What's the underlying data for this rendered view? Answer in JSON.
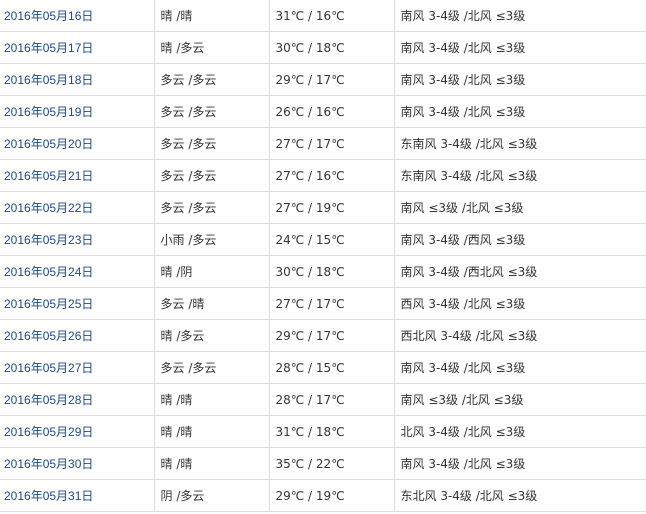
{
  "rows": [
    {
      "date": "2016年05月16日",
      "condition": "晴 /晴",
      "temp": "31℃ / 16℃",
      "wind": "南风 3-4级 /北风 ≤3级"
    },
    {
      "date": "2016年05月17日",
      "condition": "晴 /多云",
      "temp": "30℃ / 18℃",
      "wind": "南风 3-4级 /北风 ≤3级"
    },
    {
      "date": "2016年05月18日",
      "condition": "多云 /多云",
      "temp": "29℃ / 17℃",
      "wind": "南风 3-4级 /北风 ≤3级"
    },
    {
      "date": "2016年05月19日",
      "condition": "多云 /多云",
      "temp": "26℃ / 16℃",
      "wind": "南风 3-4级 /北风 ≤3级"
    },
    {
      "date": "2016年05月20日",
      "condition": "多云 /多云",
      "temp": "27℃ / 17℃",
      "wind": "东南风 3-4级 /北风 ≤3级"
    },
    {
      "date": "2016年05月21日",
      "condition": "多云 /多云",
      "temp": "27℃ / 16℃",
      "wind": "东南风 3-4级 /北风 ≤3级"
    },
    {
      "date": "2016年05月22日",
      "condition": "多云 /多云",
      "temp": "27℃ / 19℃",
      "wind": "南风 ≤3级 /北风 ≤3级"
    },
    {
      "date": "2016年05月23日",
      "condition": "小雨 /多云",
      "temp": "24℃ / 15℃",
      "wind": "南风 3-4级 /西风 ≤3级"
    },
    {
      "date": "2016年05月24日",
      "condition": "晴 /阴",
      "temp": "30℃ / 18℃",
      "wind": "南风 3-4级 /西北风 ≤3级"
    },
    {
      "date": "2016年05月25日",
      "condition": "多云 /晴",
      "temp": "27℃ / 17℃",
      "wind": "西风 3-4级 /北风 ≤3级"
    },
    {
      "date": "2016年05月26日",
      "condition": "晴 /多云",
      "temp": "29℃ / 17℃",
      "wind": "西北风 3-4级 /北风 ≤3级"
    },
    {
      "date": "2016年05月27日",
      "condition": "多云 /多云",
      "temp": "28℃ / 15℃",
      "wind": "南风 3-4级 /北风 ≤3级"
    },
    {
      "date": "2016年05月28日",
      "condition": "晴 /晴",
      "temp": "28℃ / 17℃",
      "wind": "南风 ≤3级 /北风 ≤3级"
    },
    {
      "date": "2016年05月29日",
      "condition": "晴 /晴",
      "temp": "31℃ / 18℃",
      "wind": "北风 3-4级 /北风 ≤3级"
    },
    {
      "date": "2016年05月30日",
      "condition": "晴 /晴",
      "temp": "35℃ / 22℃",
      "wind": "南风 3-4级 /北风 ≤3级"
    },
    {
      "date": "2016年05月31日",
      "condition": "阴 /多云",
      "temp": "29℃ / 19℃",
      "wind": "东北风 3-4级 /北风 ≤3级"
    }
  ],
  "colors": {
    "link": "#1a4a8a",
    "text": "#333333",
    "border": "#dcdcdc"
  }
}
